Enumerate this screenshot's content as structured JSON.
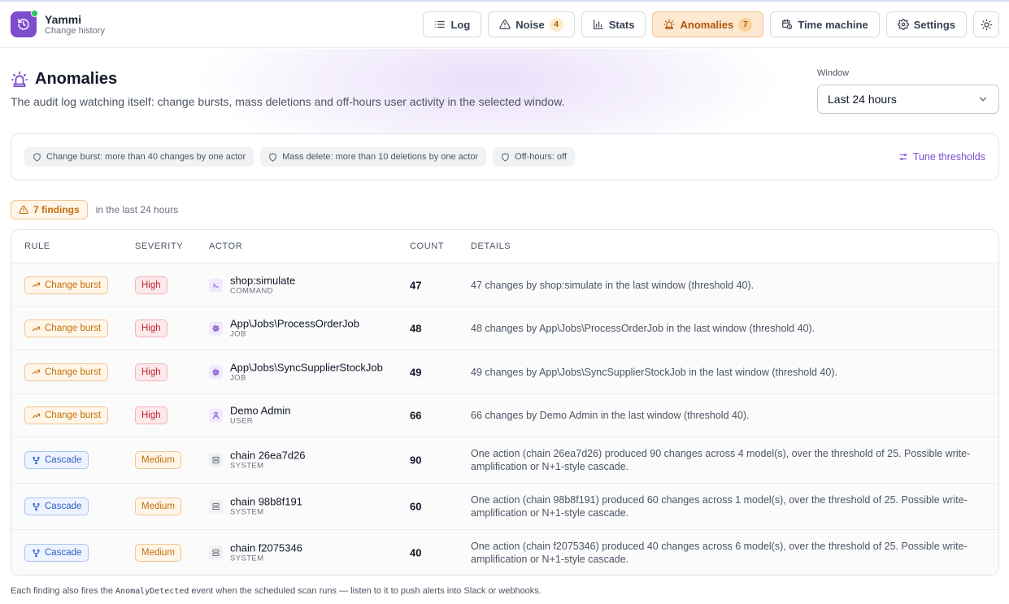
{
  "app": {
    "name": "Yammi",
    "subtitle": "Change history"
  },
  "nav": [
    {
      "label": "Log",
      "icon": "list-icon",
      "count": ""
    },
    {
      "label": "Noise",
      "icon": "warning-icon",
      "count": "4"
    },
    {
      "label": "Stats",
      "icon": "bar-chart-icon",
      "count": ""
    },
    {
      "label": "Anomalies",
      "icon": "alarm-icon",
      "count": "7",
      "active": true
    },
    {
      "label": "Time machine",
      "icon": "calendar-clock-icon",
      "count": ""
    },
    {
      "label": "Settings",
      "icon": "gear-icon",
      "count": ""
    }
  ],
  "theme_toggle_icon": "sun-icon",
  "page": {
    "title": "Anomalies",
    "description": "The audit log watching itself: change bursts, mass deletions and off-hours user activity in the selected window."
  },
  "window": {
    "label": "Window",
    "value": "Last 24 hours"
  },
  "rules": [
    "Change burst: more than 40 changes by one actor",
    "Mass delete: more than 10 deletions by one actor",
    "Off-hours: off"
  ],
  "tune_label": "Tune thresholds",
  "findings": {
    "badge": "7 findings",
    "suffix": "in the last 24 hours"
  },
  "table": {
    "columns": [
      "RULE",
      "SEVERITY",
      "ACTOR",
      "COUNT",
      "DETAILS"
    ],
    "rows": [
      {
        "rule": "Change burst",
        "kind": "burst",
        "severity": "High",
        "actor": "shop:simulate",
        "actor_type": "COMMAND",
        "actor_icon": "terminal-icon",
        "count": "47",
        "details": "47 changes by shop:simulate in the last window (threshold 40)."
      },
      {
        "rule": "Change burst",
        "kind": "burst",
        "severity": "High",
        "actor": "App\\Jobs\\ProcessOrderJob",
        "actor_type": "JOB",
        "actor_icon": "cog-icon",
        "count": "48",
        "details": "48 changes by App\\Jobs\\ProcessOrderJob in the last window (threshold 40)."
      },
      {
        "rule": "Change burst",
        "kind": "burst",
        "severity": "High",
        "actor": "App\\Jobs\\SyncSupplierStockJob",
        "actor_type": "JOB",
        "actor_icon": "cog-icon",
        "count": "49",
        "details": "49 changes by App\\Jobs\\SyncSupplierStockJob in the last window (threshold 40)."
      },
      {
        "rule": "Change burst",
        "kind": "burst",
        "severity": "High",
        "actor": "Demo Admin",
        "actor_type": "USER",
        "actor_icon": "user-icon",
        "count": "66",
        "details": "66 changes by Demo Admin in the last window (threshold 40)."
      },
      {
        "rule": "Cascade",
        "kind": "cascade",
        "severity": "Medium",
        "actor": "chain 26ea7d26",
        "actor_type": "SYSTEM",
        "actor_icon": "server-icon",
        "count": "90",
        "details": "One action (chain 26ea7d26) produced 90 changes across 4 model(s), over the threshold of 25. Possible write-amplification or N+1-style cascade."
      },
      {
        "rule": "Cascade",
        "kind": "cascade",
        "severity": "Medium",
        "actor": "chain 98b8f191",
        "actor_type": "SYSTEM",
        "actor_icon": "server-icon",
        "count": "60",
        "details": "One action (chain 98b8f191) produced 60 changes across 1 model(s), over the threshold of 25. Possible write-amplification or N+1-style cascade."
      },
      {
        "rule": "Cascade",
        "kind": "cascade",
        "severity": "Medium",
        "actor": "chain f2075346",
        "actor_type": "SYSTEM",
        "actor_icon": "server-icon",
        "count": "40",
        "details": "One action (chain f2075346) produced 40 changes across 6 model(s), over the threshold of 25. Possible write-amplification or N+1-style cascade."
      }
    ]
  },
  "footnote": {
    "before": "Each finding also fires the ",
    "code": "AnomalyDetected",
    "after": " event when the scheduled scan runs — listen to it to push alerts into Slack or webhooks."
  },
  "colors": {
    "accent": "#7c4dcc",
    "warning": "#c2710c",
    "danger": "#c02638",
    "info": "#2f5fc4",
    "online": "#22c55e"
  }
}
